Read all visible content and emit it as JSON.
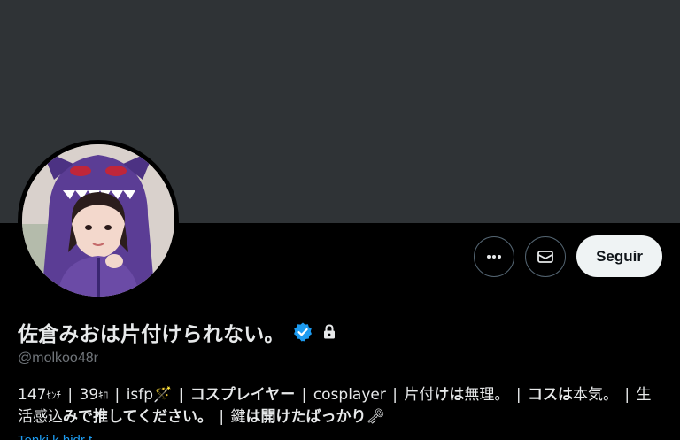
{
  "profile": {
    "display_name": "佐倉みおは片付けられない。",
    "handle": "@molkoo48r",
    "verified": true,
    "protected": true
  },
  "actions": {
    "more_icon": "more-horizontal-icon",
    "message_icon": "envelope-icon",
    "follow_label": "Seguir"
  },
  "bio": {
    "height": "147",
    "height_unit": "ｾﾝﾁ",
    "age": "39",
    "age_unit": "ｷﾛ",
    "mbti": "isfp",
    "mbti_emoji": "🪄",
    "role": "コスプレイヤー",
    "role_en": "cosplayer",
    "tidy_a": "片付",
    "tidy_b": "けは",
    "tidy_c": "無理。",
    "cos_a": "コスは",
    "cos_b": "本気。",
    "life_a": "生活感込",
    "life_b": "みで推してください。",
    "key_a": "鍵",
    "key_b": "は",
    "key_c": "開けたばっかり",
    "key_emoji": "🗝"
  },
  "link_peek": "Tenki k  hidr  t  "
}
